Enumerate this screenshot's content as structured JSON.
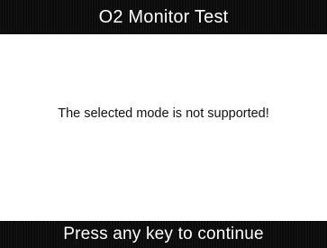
{
  "header": {
    "title": "O2 Monitor Test"
  },
  "main": {
    "message": "The selected mode is not supported!"
  },
  "footer": {
    "prompt": "Press any key to continue"
  },
  "colors": {
    "bar_background": "#0b0b0b",
    "bar_text": "#ffffff",
    "content_background": "#ffffff",
    "content_text": "#111111"
  }
}
